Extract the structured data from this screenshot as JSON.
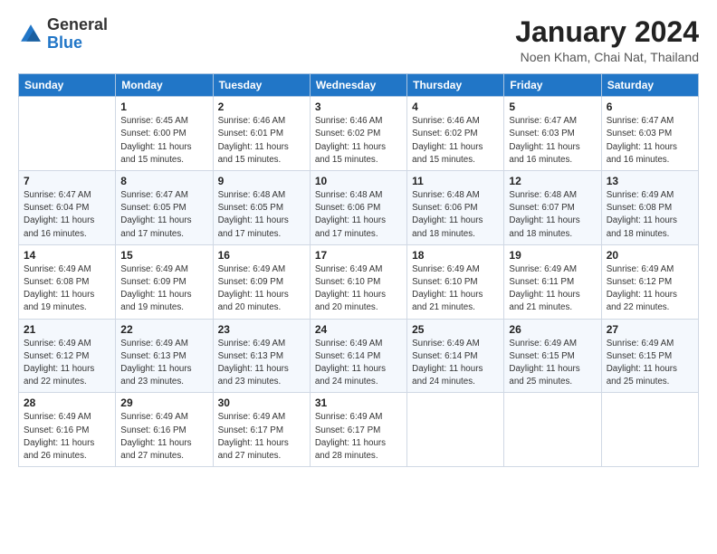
{
  "header": {
    "logo_line1": "General",
    "logo_line2": "Blue",
    "month_title": "January 2024",
    "location": "Noen Kham, Chai Nat, Thailand"
  },
  "weekdays": [
    "Sunday",
    "Monday",
    "Tuesday",
    "Wednesday",
    "Thursday",
    "Friday",
    "Saturday"
  ],
  "weeks": [
    [
      {
        "day": "",
        "sunrise": "",
        "sunset": "",
        "daylight": ""
      },
      {
        "day": "1",
        "sunrise": "Sunrise: 6:45 AM",
        "sunset": "Sunset: 6:00 PM",
        "daylight": "Daylight: 11 hours and 15 minutes."
      },
      {
        "day": "2",
        "sunrise": "Sunrise: 6:46 AM",
        "sunset": "Sunset: 6:01 PM",
        "daylight": "Daylight: 11 hours and 15 minutes."
      },
      {
        "day": "3",
        "sunrise": "Sunrise: 6:46 AM",
        "sunset": "Sunset: 6:02 PM",
        "daylight": "Daylight: 11 hours and 15 minutes."
      },
      {
        "day": "4",
        "sunrise": "Sunrise: 6:46 AM",
        "sunset": "Sunset: 6:02 PM",
        "daylight": "Daylight: 11 hours and 15 minutes."
      },
      {
        "day": "5",
        "sunrise": "Sunrise: 6:47 AM",
        "sunset": "Sunset: 6:03 PM",
        "daylight": "Daylight: 11 hours and 16 minutes."
      },
      {
        "day": "6",
        "sunrise": "Sunrise: 6:47 AM",
        "sunset": "Sunset: 6:03 PM",
        "daylight": "Daylight: 11 hours and 16 minutes."
      }
    ],
    [
      {
        "day": "7",
        "sunrise": "Sunrise: 6:47 AM",
        "sunset": "Sunset: 6:04 PM",
        "daylight": "Daylight: 11 hours and 16 minutes."
      },
      {
        "day": "8",
        "sunrise": "Sunrise: 6:47 AM",
        "sunset": "Sunset: 6:05 PM",
        "daylight": "Daylight: 11 hours and 17 minutes."
      },
      {
        "day": "9",
        "sunrise": "Sunrise: 6:48 AM",
        "sunset": "Sunset: 6:05 PM",
        "daylight": "Daylight: 11 hours and 17 minutes."
      },
      {
        "day": "10",
        "sunrise": "Sunrise: 6:48 AM",
        "sunset": "Sunset: 6:06 PM",
        "daylight": "Daylight: 11 hours and 17 minutes."
      },
      {
        "day": "11",
        "sunrise": "Sunrise: 6:48 AM",
        "sunset": "Sunset: 6:06 PM",
        "daylight": "Daylight: 11 hours and 18 minutes."
      },
      {
        "day": "12",
        "sunrise": "Sunrise: 6:48 AM",
        "sunset": "Sunset: 6:07 PM",
        "daylight": "Daylight: 11 hours and 18 minutes."
      },
      {
        "day": "13",
        "sunrise": "Sunrise: 6:49 AM",
        "sunset": "Sunset: 6:08 PM",
        "daylight": "Daylight: 11 hours and 18 minutes."
      }
    ],
    [
      {
        "day": "14",
        "sunrise": "Sunrise: 6:49 AM",
        "sunset": "Sunset: 6:08 PM",
        "daylight": "Daylight: 11 hours and 19 minutes."
      },
      {
        "day": "15",
        "sunrise": "Sunrise: 6:49 AM",
        "sunset": "Sunset: 6:09 PM",
        "daylight": "Daylight: 11 hours and 19 minutes."
      },
      {
        "day": "16",
        "sunrise": "Sunrise: 6:49 AM",
        "sunset": "Sunset: 6:09 PM",
        "daylight": "Daylight: 11 hours and 20 minutes."
      },
      {
        "day": "17",
        "sunrise": "Sunrise: 6:49 AM",
        "sunset": "Sunset: 6:10 PM",
        "daylight": "Daylight: 11 hours and 20 minutes."
      },
      {
        "day": "18",
        "sunrise": "Sunrise: 6:49 AM",
        "sunset": "Sunset: 6:10 PM",
        "daylight": "Daylight: 11 hours and 21 minutes."
      },
      {
        "day": "19",
        "sunrise": "Sunrise: 6:49 AM",
        "sunset": "Sunset: 6:11 PM",
        "daylight": "Daylight: 11 hours and 21 minutes."
      },
      {
        "day": "20",
        "sunrise": "Sunrise: 6:49 AM",
        "sunset": "Sunset: 6:12 PM",
        "daylight": "Daylight: 11 hours and 22 minutes."
      }
    ],
    [
      {
        "day": "21",
        "sunrise": "Sunrise: 6:49 AM",
        "sunset": "Sunset: 6:12 PM",
        "daylight": "Daylight: 11 hours and 22 minutes."
      },
      {
        "day": "22",
        "sunrise": "Sunrise: 6:49 AM",
        "sunset": "Sunset: 6:13 PM",
        "daylight": "Daylight: 11 hours and 23 minutes."
      },
      {
        "day": "23",
        "sunrise": "Sunrise: 6:49 AM",
        "sunset": "Sunset: 6:13 PM",
        "daylight": "Daylight: 11 hours and 23 minutes."
      },
      {
        "day": "24",
        "sunrise": "Sunrise: 6:49 AM",
        "sunset": "Sunset: 6:14 PM",
        "daylight": "Daylight: 11 hours and 24 minutes."
      },
      {
        "day": "25",
        "sunrise": "Sunrise: 6:49 AM",
        "sunset": "Sunset: 6:14 PM",
        "daylight": "Daylight: 11 hours and 24 minutes."
      },
      {
        "day": "26",
        "sunrise": "Sunrise: 6:49 AM",
        "sunset": "Sunset: 6:15 PM",
        "daylight": "Daylight: 11 hours and 25 minutes."
      },
      {
        "day": "27",
        "sunrise": "Sunrise: 6:49 AM",
        "sunset": "Sunset: 6:15 PM",
        "daylight": "Daylight: 11 hours and 25 minutes."
      }
    ],
    [
      {
        "day": "28",
        "sunrise": "Sunrise: 6:49 AM",
        "sunset": "Sunset: 6:16 PM",
        "daylight": "Daylight: 11 hours and 26 minutes."
      },
      {
        "day": "29",
        "sunrise": "Sunrise: 6:49 AM",
        "sunset": "Sunset: 6:16 PM",
        "daylight": "Daylight: 11 hours and 27 minutes."
      },
      {
        "day": "30",
        "sunrise": "Sunrise: 6:49 AM",
        "sunset": "Sunset: 6:17 PM",
        "daylight": "Daylight: 11 hours and 27 minutes."
      },
      {
        "day": "31",
        "sunrise": "Sunrise: 6:49 AM",
        "sunset": "Sunset: 6:17 PM",
        "daylight": "Daylight: 11 hours and 28 minutes."
      },
      {
        "day": "",
        "sunrise": "",
        "sunset": "",
        "daylight": ""
      },
      {
        "day": "",
        "sunrise": "",
        "sunset": "",
        "daylight": ""
      },
      {
        "day": "",
        "sunrise": "",
        "sunset": "",
        "daylight": ""
      }
    ]
  ]
}
